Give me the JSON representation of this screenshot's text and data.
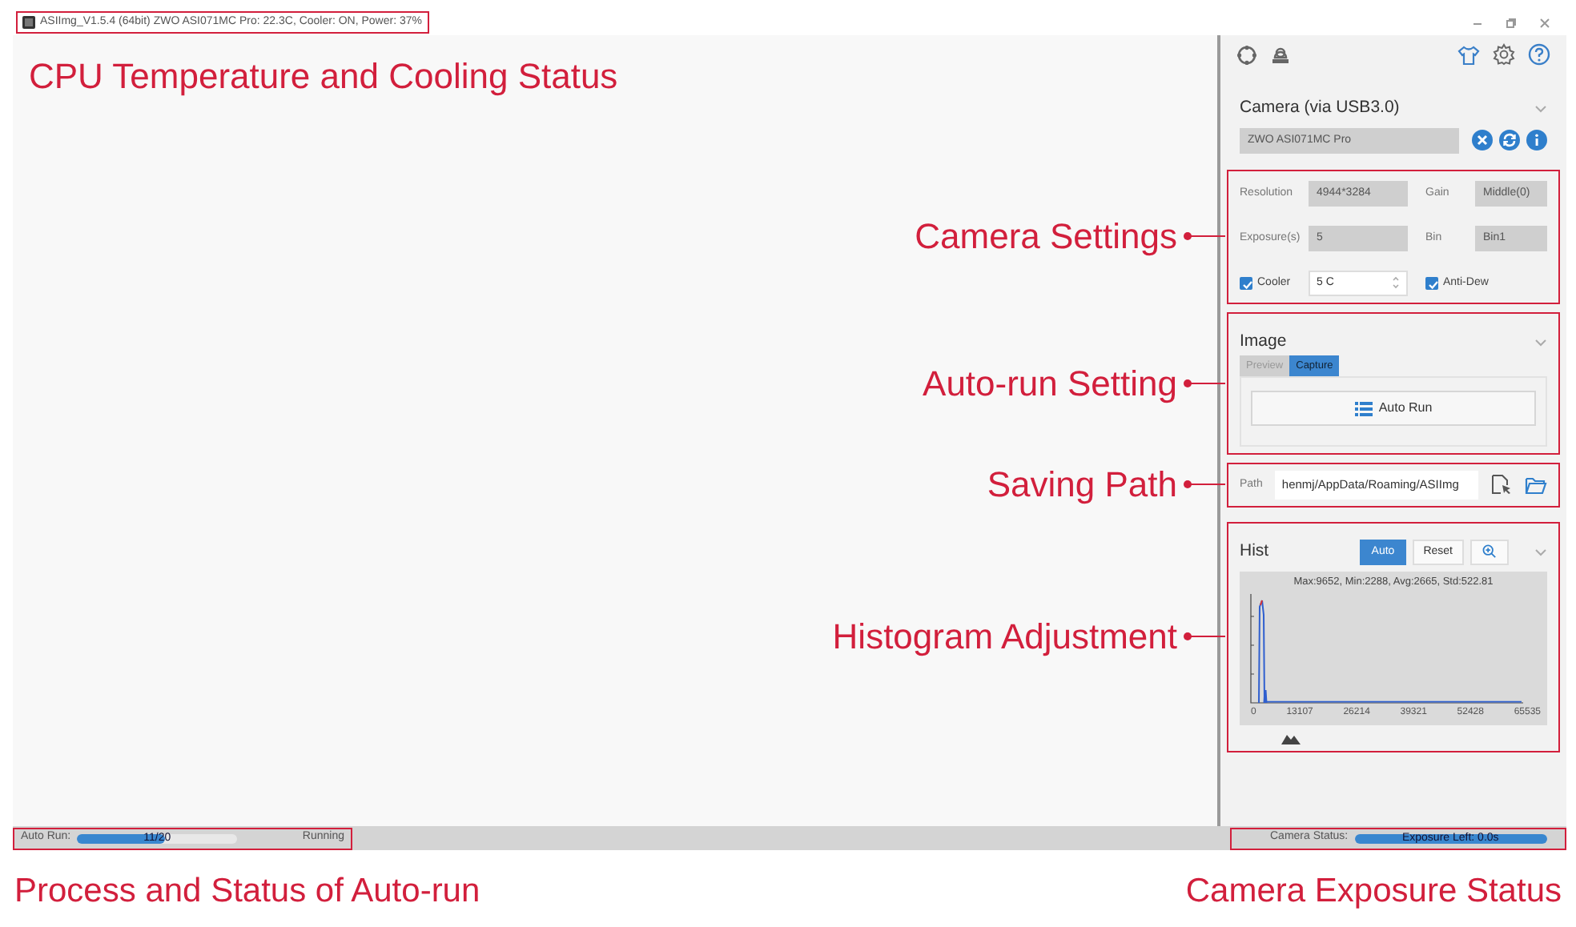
{
  "window": {
    "title": "ASIImg_V1.5.4 (64bit) ZWO ASI071MC Pro: 22.3C, Cooler: ON, Power: 37%",
    "highlighted": true,
    "annotation": "CPU Temperature and Cooling Status"
  },
  "camera": {
    "title": "Camera (via USB3.0)",
    "device": "ZWO ASI071MC Pro"
  },
  "settings": {
    "highlighted": true,
    "annotation": "Camera Settings",
    "fields": [
      {
        "label": "Resolution",
        "value": "4944*3284"
      },
      {
        "label": "Gain",
        "value": "Middle(0)"
      },
      {
        "label": "Exposure(s)",
        "value": "5"
      },
      {
        "label": "Bin",
        "value": "Bin1"
      }
    ],
    "cooler": {
      "label": "Cooler",
      "checked": true,
      "value": "5 C"
    },
    "anti_dew": {
      "label": "Anti-Dew",
      "checked": true
    }
  },
  "image": {
    "highlighted": true,
    "annotation": "Auto-run Setting",
    "title": "Image",
    "tabs": [
      {
        "label": "Preview",
        "selected": false
      },
      {
        "label": "Capture",
        "selected": true
      }
    ],
    "button": "Auto Run"
  },
  "path": {
    "highlighted": true,
    "annotation": "Saving Path",
    "label": "Path",
    "value": "henmj/AppData/Roaming/ASIImg"
  },
  "histogram": {
    "highlighted": true,
    "annotation": "Histogram Adjustment",
    "title": "Hist",
    "buttons": [
      {
        "label": "Auto",
        "selected": true
      },
      {
        "label": "Reset",
        "selected": false
      }
    ],
    "stats": "Max:9652, Min:2288, Avg:2665, Std:522.81",
    "x_tick_labels": [
      "0",
      "13107",
      "26214",
      "39321",
      "52428",
      "65535"
    ]
  },
  "status_bar": {
    "auto_run": {
      "highlighted": true,
      "annotation": "Process and Status of Auto-run",
      "label": "Auto Run:",
      "level": 0.55,
      "reading": "11/20",
      "state": "Running"
    },
    "camera_status": {
      "highlighted": true,
      "annotation": "Camera Exposure Status",
      "label": "Camera Status:",
      "level": 1,
      "reading": "Exposure Left: 0.0s"
    }
  }
}
